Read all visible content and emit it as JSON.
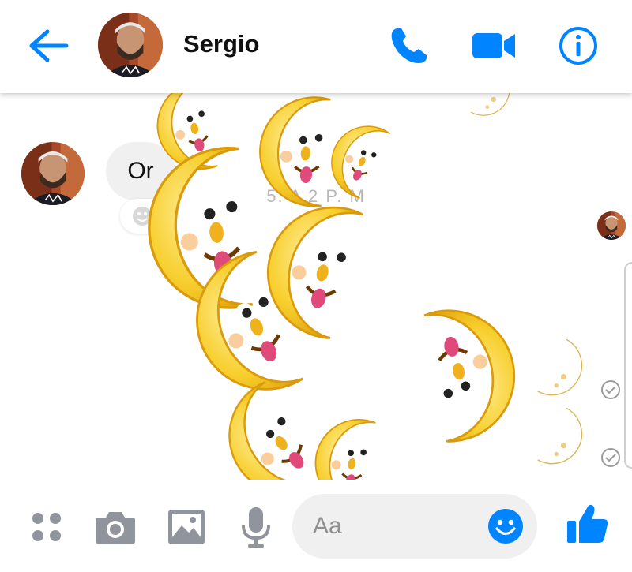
{
  "header": {
    "contact_name": "Sergio"
  },
  "chat": {
    "timestamp": "5. A    2 P. M",
    "received_message": "Or",
    "reaction_add_label": "+"
  },
  "composer": {
    "placeholder": "Aa"
  },
  "icons": {
    "back": "arrow-left-icon",
    "call": "phone-icon",
    "video": "video-camera-icon",
    "info": "info-icon",
    "more": "grid-dots-icon",
    "camera": "camera-icon",
    "gallery": "image-icon",
    "voice": "microphone-icon",
    "emoji": "smiley-icon",
    "like": "thumbs-up-icon",
    "read_receipt": "check-circle-icon"
  },
  "colors": {
    "accent": "#0084ff",
    "icon_gray": "#90949c",
    "bubble": "#f1f0f0",
    "moon": "#f9d23a"
  }
}
